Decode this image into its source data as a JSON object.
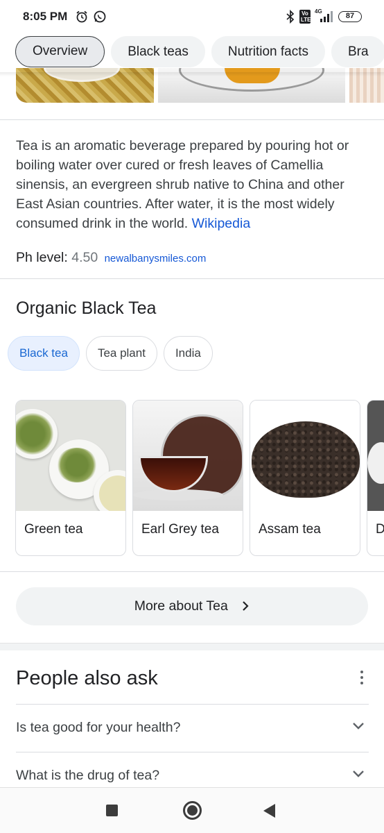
{
  "status_bar": {
    "time": "8:05 PM",
    "left_icons": [
      "alarm-icon",
      "whatsapp-icon"
    ],
    "right_icons": [
      "bluetooth-icon",
      "volte-icon",
      "signal-4g-icon"
    ],
    "volte_label": "Vo LTE",
    "network_label": "4G",
    "battery": "87"
  },
  "tabs": [
    {
      "label": "Overview",
      "selected": true
    },
    {
      "label": "Black teas",
      "selected": false
    },
    {
      "label": "Nutrition facts",
      "selected": false
    },
    {
      "label": "Bra",
      "selected": false
    }
  ],
  "description": {
    "text": "Tea is an aromatic beverage prepared by pouring hot or boiling water over cured or fresh leaves of Camellia sinensis, an evergreen shrub native to China and other East Asian countries. After water, it is the most widely consumed drink in the world.",
    "source_link": "Wikipedia"
  },
  "ph": {
    "label": "Ph level:",
    "value": "4.50",
    "source": "newalbanysmiles.com"
  },
  "organic": {
    "title": "Organic Black Tea",
    "filters": [
      {
        "label": "Black tea",
        "active": true
      },
      {
        "label": "Tea plant",
        "active": false
      },
      {
        "label": "India",
        "active": false
      }
    ],
    "cards": [
      {
        "label": "Green tea"
      },
      {
        "label": "Earl Grey tea"
      },
      {
        "label": "Assam tea"
      },
      {
        "label": "D"
      }
    ]
  },
  "more_button": {
    "label": "More about Tea",
    "icon": "chevron-right-icon"
  },
  "people_also_ask": {
    "title": "People also ask",
    "menu_icon": "more-vert-icon",
    "questions": [
      "Is tea good for your health?",
      "What is the drug of tea?"
    ]
  },
  "nav_bar": {
    "icons": [
      "recents-icon",
      "home-icon",
      "back-icon"
    ]
  },
  "colors": {
    "link": "#1558d6",
    "active_chip_bg": "#e8f0fe",
    "active_chip_text": "#1967d2",
    "chip_bg": "#f1f3f4"
  }
}
